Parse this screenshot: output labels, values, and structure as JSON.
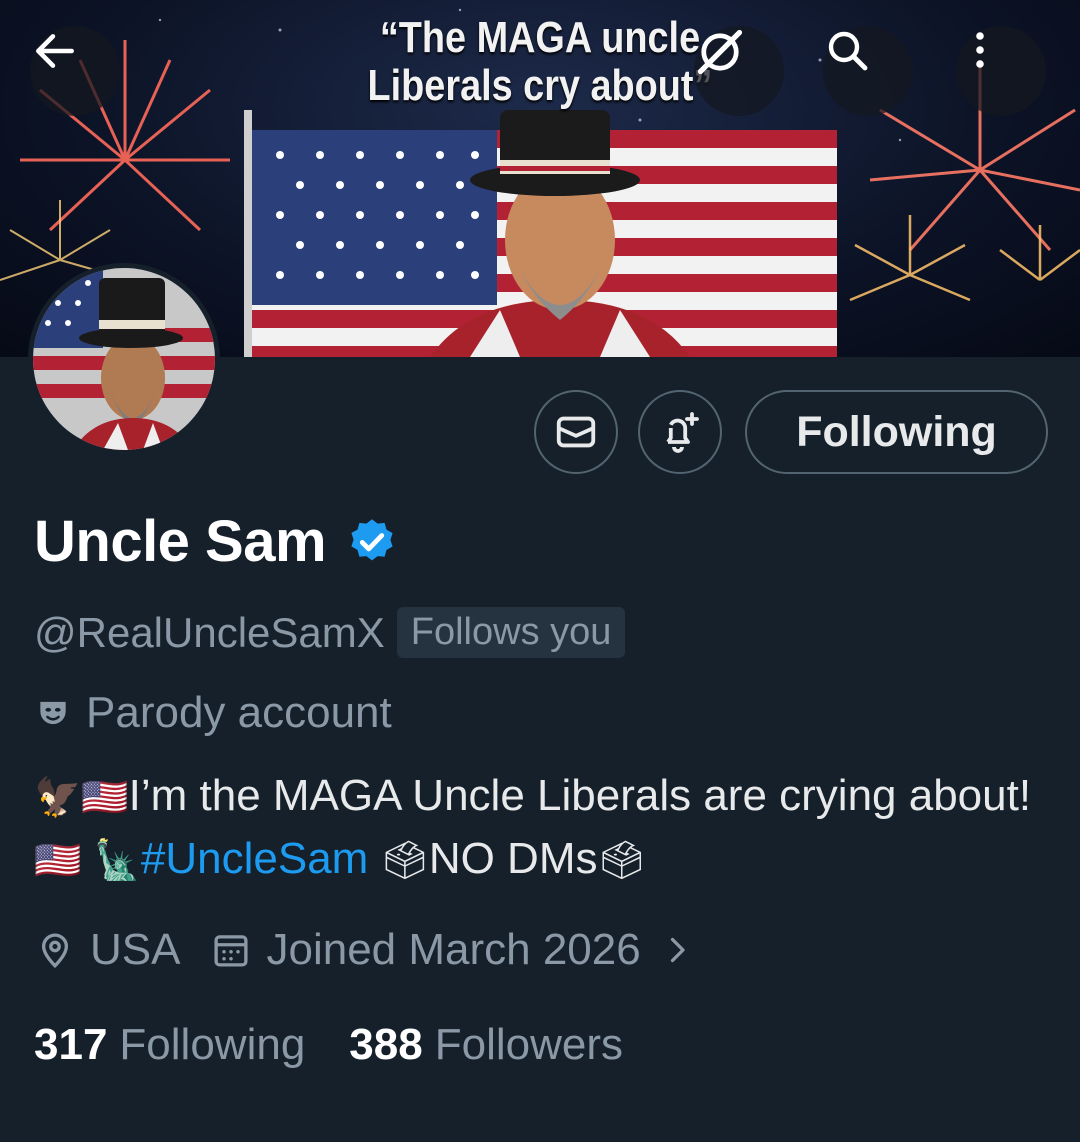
{
  "banner": {
    "caption_line1": "“The MAGA uncle",
    "caption_line2": "Liberals cry about”"
  },
  "nav": {
    "back_icon": "arrow-left-icon",
    "grok_icon": "grok-icon",
    "search_icon": "search-icon",
    "more_icon": "more-vertical-icon"
  },
  "actions": {
    "message_icon": "envelope-icon",
    "notify_icon": "bell-plus-icon",
    "following_label": "Following"
  },
  "profile": {
    "name": "Uncle Sam",
    "verified_icon": "verified-badge-icon",
    "handle": "@RealUncleSamX",
    "follows_you": "Follows you",
    "parody_label": "Parody account",
    "bio_part1": "I’m the MAGA Uncle Liberals are crying about! ",
    "hashtag": "#UncleSam",
    "bio_part2": "NO DMs",
    "emoji_eagle": "🦅",
    "emoji_flag": "🇺🇸",
    "emoji_liberty": "🗽",
    "emoji_ballot": "🗳",
    "location": "USA",
    "joined": "Joined March 2026",
    "following_count": "317",
    "following_label": "Following",
    "followers_count": "388",
    "followers_label": "Followers"
  },
  "colors": {
    "background": "#15202b",
    "accent": "#1d9bf0",
    "secondary_text": "#8b98a5",
    "border": "#536471"
  }
}
